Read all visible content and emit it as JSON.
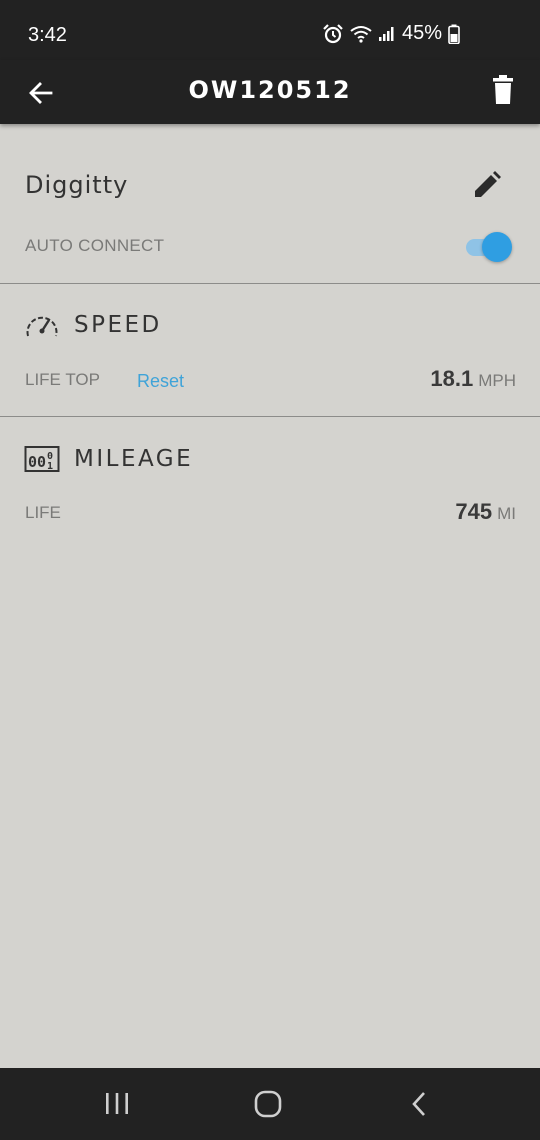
{
  "status_bar": {
    "time": "3:42",
    "battery": "45%",
    "icons": [
      "alarm-icon",
      "wifi-icon",
      "signal-icon",
      "battery-icon"
    ]
  },
  "app_bar": {
    "title": "OW120512",
    "back_icon": "back-arrow-icon",
    "delete_icon": "trash-icon"
  },
  "board": {
    "name": "Diggitty",
    "edit_icon": "pencil-icon",
    "auto_connect_label": "AUTO CONNECT",
    "auto_connect_on": true
  },
  "speed": {
    "title": "SPEED",
    "icon": "speedometer-icon",
    "label": "LIFE TOP",
    "reset_label": "Reset",
    "value": "18.1",
    "unit": "MPH"
  },
  "mileage": {
    "title": "MILEAGE",
    "icon": "odometer-icon",
    "label": "LIFE",
    "value": "745",
    "unit": "MI"
  },
  "nav_bar": {
    "buttons": [
      "recents-icon",
      "home-icon",
      "back-icon"
    ]
  },
  "colors": {
    "background": "#d4d3cf",
    "bar": "#222222",
    "accent": "#2f9ee2",
    "link": "#3fa3d8"
  }
}
